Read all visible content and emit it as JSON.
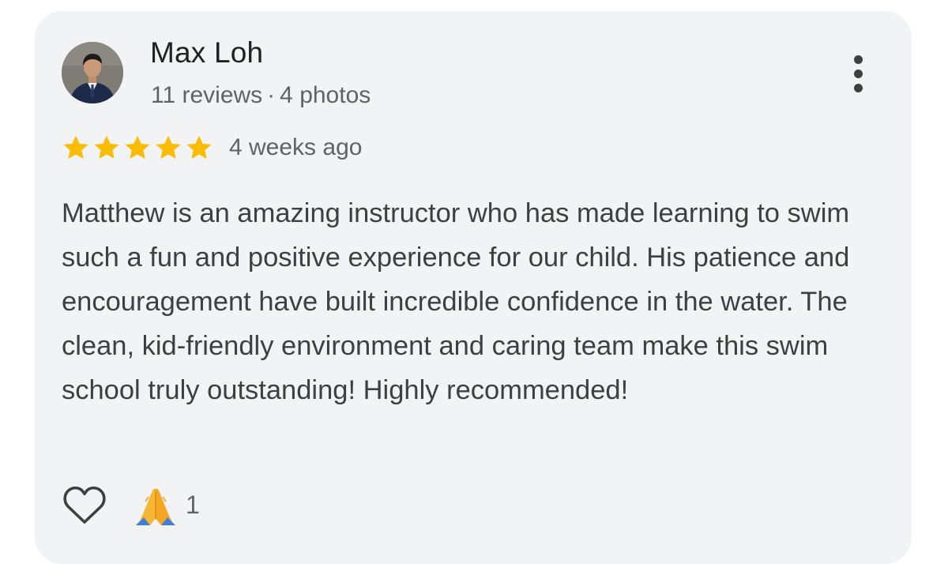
{
  "review": {
    "author_name": "Max Loh",
    "review_count": "11 reviews",
    "separator": "·",
    "photo_count": "4 photos",
    "rating": 5,
    "rating_max": 5,
    "time_ago": "4 weeks ago",
    "text": "Matthew is an amazing instructor who has made learning to swim such a fun and positive experience for our child. His patience and encouragement have built incredible confidence in the water. The clean, kid-friendly environment and caring team make this swim school truly outstanding! Highly recommended!",
    "reactions": {
      "like_icon": "heart-outline-icon",
      "emoji_icon": "folded-hands-icon",
      "count": "1"
    }
  },
  "icons": {
    "menu": "more-vertical-icon",
    "star": "star-icon",
    "avatar": "avatar-photo"
  },
  "colors": {
    "card_background": "#f2f3f5",
    "star": "#fbbc04",
    "author_name": "#202124",
    "secondary_text": "#5f6368",
    "body_text": "#3c4043"
  }
}
